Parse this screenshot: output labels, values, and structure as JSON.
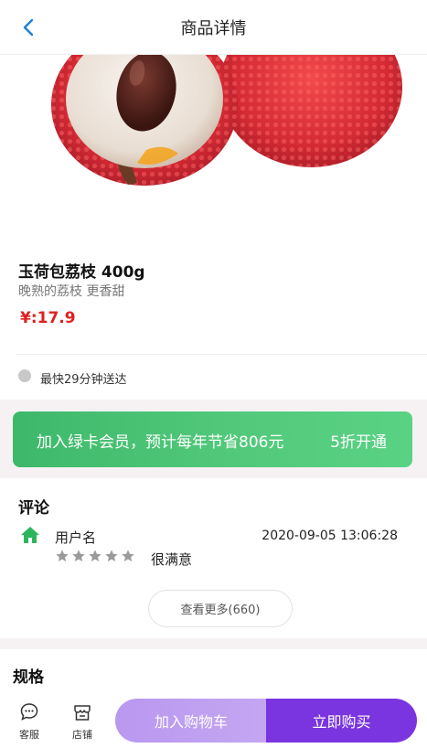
{
  "header": {
    "title": "商品详情",
    "back_icon": "chevron-left-icon"
  },
  "product": {
    "name": "玉荷包荔枝 400g",
    "subtitle": "晚熟的荔枝 更香甜",
    "price": "¥:17.9",
    "delivery": "最快29分钟送达"
  },
  "member": {
    "text": "加入绿卡会员，预计每年节省806元",
    "action": "5折开通"
  },
  "comments": {
    "title": "评论",
    "user": "用户名",
    "time": "2020-09-05 13:06:28",
    "rating": 5,
    "text": "很满意",
    "more_label": "查看更多(660)"
  },
  "spec": {
    "title": "规格"
  },
  "bottom": {
    "service_label": "客服",
    "service_icon": "chat-bubble-icon",
    "shop_label": "店铺",
    "shop_icon": "store-icon",
    "cart_label": "加入购物车",
    "buy_label": "立即购买"
  },
  "colors": {
    "price": "#e02020",
    "member_banner": "#4cc377",
    "buy_button": "#7b35e0",
    "cart_button": "#bfa0f0",
    "home_icon": "#2db55d"
  }
}
